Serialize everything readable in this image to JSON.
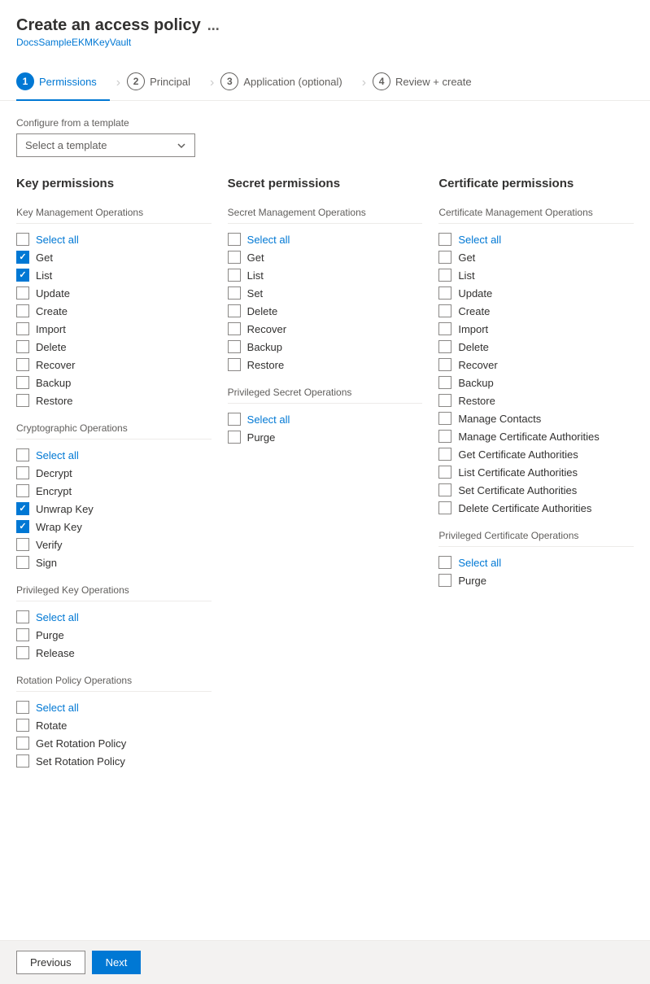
{
  "header": {
    "title": "Create an access policy",
    "subtitle": "DocsSampleEKMKeyVault",
    "dots": "..."
  },
  "tabs": [
    {
      "num": "1",
      "label": "Permissions",
      "active": true
    },
    {
      "num": "2",
      "label": "Principal",
      "active": false
    },
    {
      "num": "3",
      "label": "Application (optional)",
      "active": false
    },
    {
      "num": "4",
      "label": "Review + create",
      "active": false
    }
  ],
  "configure_label": "Configure from a template",
  "template_placeholder": "Select a template",
  "columns": [
    {
      "title": "Key permissions",
      "groups": [
        {
          "name": "Key Management Operations",
          "items": [
            {
              "label": "Select all",
              "checked": false,
              "blue": true
            },
            {
              "label": "Get",
              "checked": true,
              "blue": false
            },
            {
              "label": "List",
              "checked": true,
              "blue": false
            },
            {
              "label": "Update",
              "checked": false,
              "blue": false
            },
            {
              "label": "Create",
              "checked": false,
              "blue": false
            },
            {
              "label": "Import",
              "checked": false,
              "blue": false
            },
            {
              "label": "Delete",
              "checked": false,
              "blue": false
            },
            {
              "label": "Recover",
              "checked": false,
              "blue": false
            },
            {
              "label": "Backup",
              "checked": false,
              "blue": false
            },
            {
              "label": "Restore",
              "checked": false,
              "blue": false
            }
          ]
        },
        {
          "name": "Cryptographic Operations",
          "items": [
            {
              "label": "Select all",
              "checked": false,
              "blue": true
            },
            {
              "label": "Decrypt",
              "checked": false,
              "blue": false
            },
            {
              "label": "Encrypt",
              "checked": false,
              "blue": false
            },
            {
              "label": "Unwrap Key",
              "checked": true,
              "blue": false
            },
            {
              "label": "Wrap Key",
              "checked": true,
              "blue": false
            },
            {
              "label": "Verify",
              "checked": false,
              "blue": false
            },
            {
              "label": "Sign",
              "checked": false,
              "blue": false
            }
          ]
        },
        {
          "name": "Privileged Key Operations",
          "items": [
            {
              "label": "Select all",
              "checked": false,
              "blue": true
            },
            {
              "label": "Purge",
              "checked": false,
              "blue": false
            },
            {
              "label": "Release",
              "checked": false,
              "blue": false
            }
          ]
        },
        {
          "name": "Rotation Policy Operations",
          "items": [
            {
              "label": "Select all",
              "checked": false,
              "blue": true
            },
            {
              "label": "Rotate",
              "checked": false,
              "blue": false
            },
            {
              "label": "Get Rotation Policy",
              "checked": false,
              "blue": false
            },
            {
              "label": "Set Rotation Policy",
              "checked": false,
              "blue": false
            }
          ]
        }
      ]
    },
    {
      "title": "Secret permissions",
      "groups": [
        {
          "name": "Secret Management Operations",
          "items": [
            {
              "label": "Select all",
              "checked": false,
              "blue": true
            },
            {
              "label": "Get",
              "checked": false,
              "blue": false
            },
            {
              "label": "List",
              "checked": false,
              "blue": false
            },
            {
              "label": "Set",
              "checked": false,
              "blue": false
            },
            {
              "label": "Delete",
              "checked": false,
              "blue": false
            },
            {
              "label": "Recover",
              "checked": false,
              "blue": false
            },
            {
              "label": "Backup",
              "checked": false,
              "blue": false
            },
            {
              "label": "Restore",
              "checked": false,
              "blue": false
            }
          ]
        },
        {
          "name": "Privileged Secret Operations",
          "items": [
            {
              "label": "Select all",
              "checked": false,
              "blue": true
            },
            {
              "label": "Purge",
              "checked": false,
              "blue": false
            }
          ]
        }
      ]
    },
    {
      "title": "Certificate permissions",
      "groups": [
        {
          "name": "Certificate Management Operations",
          "items": [
            {
              "label": "Select all",
              "checked": false,
              "blue": true
            },
            {
              "label": "Get",
              "checked": false,
              "blue": false
            },
            {
              "label": "List",
              "checked": false,
              "blue": false
            },
            {
              "label": "Update",
              "checked": false,
              "blue": false
            },
            {
              "label": "Create",
              "checked": false,
              "blue": false
            },
            {
              "label": "Import",
              "checked": false,
              "blue": false
            },
            {
              "label": "Delete",
              "checked": false,
              "blue": false
            },
            {
              "label": "Recover",
              "checked": false,
              "blue": false
            },
            {
              "label": "Backup",
              "checked": false,
              "blue": false
            },
            {
              "label": "Restore",
              "checked": false,
              "blue": false
            },
            {
              "label": "Manage Contacts",
              "checked": false,
              "blue": false
            },
            {
              "label": "Manage Certificate Authorities",
              "checked": false,
              "blue": false
            },
            {
              "label": "Get Certificate Authorities",
              "checked": false,
              "blue": false
            },
            {
              "label": "List Certificate Authorities",
              "checked": false,
              "blue": false
            },
            {
              "label": "Set Certificate Authorities",
              "checked": false,
              "blue": false
            },
            {
              "label": "Delete Certificate Authorities",
              "checked": false,
              "blue": false
            }
          ]
        },
        {
          "name": "Privileged Certificate Operations",
          "items": [
            {
              "label": "Select all",
              "checked": false,
              "blue": true
            },
            {
              "label": "Purge",
              "checked": false,
              "blue": false
            }
          ]
        }
      ]
    }
  ],
  "footer": {
    "prev_label": "Previous",
    "next_label": "Next"
  }
}
